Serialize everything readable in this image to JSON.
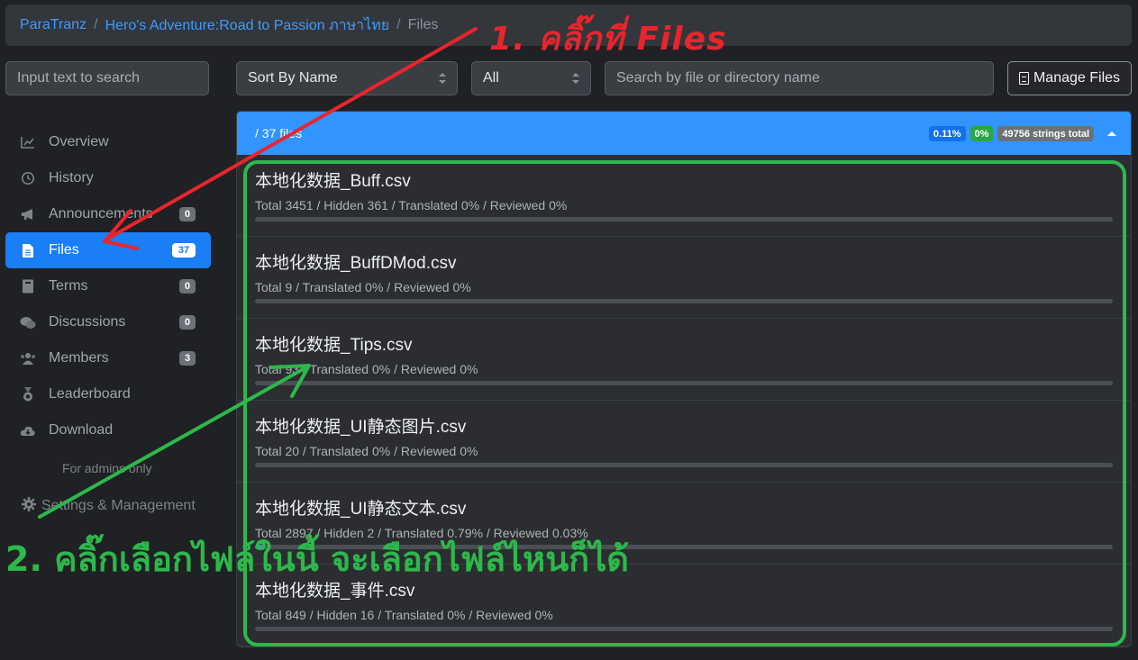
{
  "breadcrumb": {
    "root": "ParaTranz",
    "project": "Hero's Adventure:Road to Passion ภาษาไทย",
    "current": "Files"
  },
  "search": {
    "placeholder": "Input text to search"
  },
  "toolbar": {
    "sort_value": "Sort By Name",
    "filter_value": "All",
    "file_search_placeholder": "Search by file or directory name",
    "manage_label": "Manage Files"
  },
  "sidebar": {
    "items": [
      {
        "label": "Overview",
        "icon": "chart-icon"
      },
      {
        "label": "History",
        "icon": "history-icon"
      },
      {
        "label": "Announcements",
        "icon": "megaphone-icon",
        "badge": "0"
      },
      {
        "label": "Files",
        "icon": "file-icon",
        "badge": "37",
        "active": true
      },
      {
        "label": "Terms",
        "icon": "book-icon",
        "badge": "0"
      },
      {
        "label": "Discussions",
        "icon": "comments-icon",
        "badge": "0"
      },
      {
        "label": "Members",
        "icon": "users-icon",
        "badge": "3"
      },
      {
        "label": "Leaderboard",
        "icon": "medal-icon"
      },
      {
        "label": "Download",
        "icon": "cloud-download-icon"
      }
    ],
    "admin_note": "For admins only",
    "settings_label": "Settings & Management"
  },
  "panel": {
    "path": "/ 37 files",
    "badges": {
      "translated": "0.11%",
      "reviewed": "0%",
      "total": "49756 strings total"
    },
    "accent": "#3294ff"
  },
  "files": [
    {
      "name": "本地化数据_Buff.csv",
      "stats": "Total 3451 / Hidden 361 / Translated 0% / Reviewed 0%",
      "progress": 0
    },
    {
      "name": "本地化数据_BuffDMod.csv",
      "stats": "Total 9 / Translated 0% / Reviewed 0%",
      "progress": 0
    },
    {
      "name": "本地化数据_Tips.csv",
      "stats": "Total 93 / Translated 0% / Reviewed 0%",
      "progress": 0
    },
    {
      "name": "本地化数据_UI静态图片.csv",
      "stats": "Total 20 / Translated 0% / Reviewed 0%",
      "progress": 0
    },
    {
      "name": "本地化数据_UI静态文本.csv",
      "stats": "Total 2897 / Hidden 2 / Translated 0.79% / Reviewed 0.03%",
      "progress": 0.0079
    },
    {
      "name": "本地化数据_事件.csv",
      "stats": "Total 849 / Hidden 16 / Translated 0% / Reviewed 0%",
      "progress": 0
    }
  ],
  "annotations": {
    "step1": "1. คลิ๊กที่ Files",
    "step2": "2. คลิ๊กเลือกไฟล์ในนี้ จะเลือกไฟล์ไหนก็ได้",
    "step1_color": "#e8252d",
    "step2_color": "#2db84b"
  }
}
